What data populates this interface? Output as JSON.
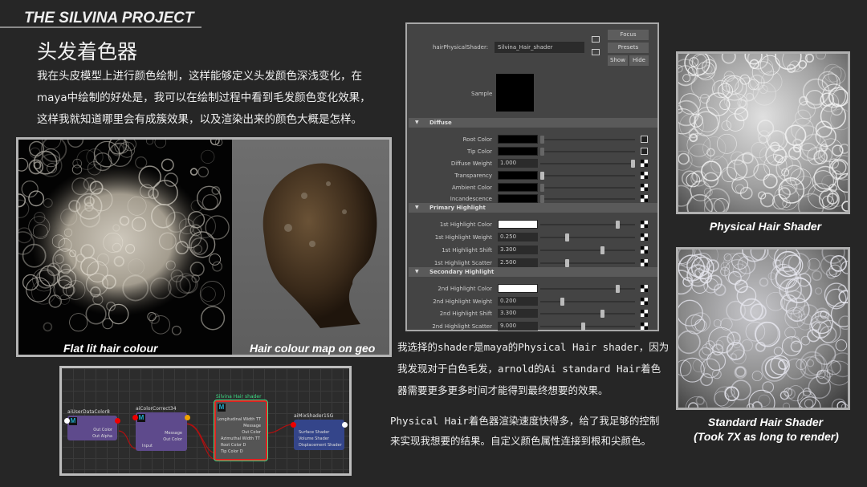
{
  "project_title": "THE SILVINA PROJECT",
  "heading": "头发着色器",
  "intro": [
    "我在头皮模型上进行颜色绘制，这样能够定义头发颜色深浅变化，在",
    "maya中绘制的好处是，我可以在绘制过程中看到毛发颜色变化效果，",
    "这样我就知道哪里会有成簇效果，以及渲染出来的颜色大概是怎样。"
  ],
  "render": {
    "left_caption": "Flat lit hair colour",
    "right_caption": "Hair colour map on geo"
  },
  "node_graph": {
    "nodes": [
      {
        "title": "aiUserDataColor8",
        "ports": [
          "Out Color",
          "Out Alpha"
        ]
      },
      {
        "title": "aiColorCorrect34",
        "ports": [
          "Message",
          "Out Color",
          "Input"
        ]
      },
      {
        "title": "Silvina Hair shader",
        "ports": [
          "Longitudinal Width TT",
          "Message",
          "Out Color",
          "Azimuthal Width TT",
          "Root Color D",
          "Tip Color D"
        ]
      },
      {
        "title": "aiMixShader1SG",
        "ports": [
          "Surface Shader",
          "Volume Shader",
          "Displacement Shader"
        ]
      }
    ],
    "selected_color": "#e02020",
    "title_color": "#3ddc84"
  },
  "attribute_editor": {
    "node_label": "hairPhysicalShader:",
    "node_name": "Silvina_Hair_shader",
    "buttons": {
      "focus": "Focus",
      "presets": "Presets",
      "show": "Show",
      "hide": "Hide"
    },
    "sample_label": "Sample",
    "sections": [
      {
        "title": "Diffuse",
        "rows": [
          {
            "label": "Root Color",
            "color": "#000000",
            "slider": 0.0,
            "icon": "map-icon"
          },
          {
            "label": "Tip Color",
            "color": "#000000",
            "slider": 0.0,
            "icon": "map-icon"
          },
          {
            "label": "Diffuse Weight",
            "value": "1.000",
            "slider": 1.0,
            "icon": "checker-icon"
          },
          {
            "label": "Transparency",
            "color": "#000000",
            "slider": 0.0,
            "icon": "checker-icon"
          },
          {
            "label": "Ambient Color",
            "color": "#000000",
            "slider": 0.0,
            "icon": "checker-icon"
          },
          {
            "label": "Incandescence",
            "color": "#000000",
            "slider": 0.0,
            "icon": "checker-icon"
          }
        ]
      },
      {
        "title": "Primary Highlight",
        "rows": [
          {
            "label": "1st Highlight Color",
            "color": "#ffffff",
            "slider": 0.83,
            "icon": "checker-icon"
          },
          {
            "label": "1st Highlight Weight",
            "value": "0.250",
            "slider": 0.27,
            "icon": "checker-icon"
          },
          {
            "label": "1st Highlight Shift",
            "value": "3.300",
            "slider": 0.66,
            "icon": "checker-icon"
          },
          {
            "label": "1st Highlight Scatter",
            "value": "2.500",
            "slider": 0.27,
            "icon": "checker-icon"
          }
        ]
      },
      {
        "title": "Secondary Highlight",
        "rows": [
          {
            "label": "2nd Highlight Color",
            "color": "#ffffff",
            "slider": 0.83,
            "icon": "checker-icon"
          },
          {
            "label": "2nd Highlight Weight",
            "value": "0.200",
            "slider": 0.22,
            "icon": "checker-icon"
          },
          {
            "label": "2nd Highlight Shift",
            "value": "3.300",
            "slider": 0.66,
            "icon": "checker-icon"
          },
          {
            "label": "2nd Highlight Scatter",
            "value": "9.000",
            "slider": 0.45,
            "icon": "checker-icon"
          }
        ]
      }
    ]
  },
  "text_shader": [
    "我选择的shader是maya的Physical Hair shader，因为",
    "我发现对于白色毛发，arnold的Ai standard Hair着色",
    "器需要更多更多时间才能得到最终想要的效果。"
  ],
  "text_speed": [
    "Physical Hair着色器渲染速度快得多，给了我足够的控制",
    "来实现我想要的结果。自定义颜色属性连接到根和尖颜色。"
  ],
  "photos": {
    "physical_caption": "Physical Hair Shader",
    "standard_caption": "Standard Hair Shader",
    "standard_note": "(Took 7X as long to render)"
  }
}
